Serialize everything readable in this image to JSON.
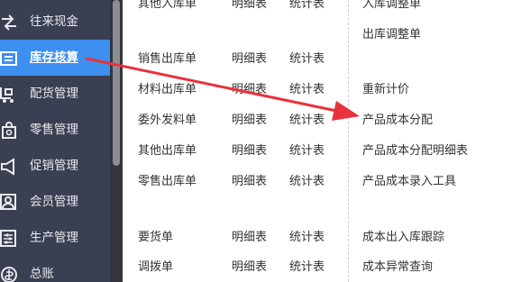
{
  "sidebar": {
    "items": [
      {
        "label": "往来现金",
        "icon": "cash-flow-icon"
      },
      {
        "label": "库存核算",
        "icon": "inventory-ledger-icon",
        "active": true
      },
      {
        "label": "配货管理",
        "icon": "distribution-icon"
      },
      {
        "label": "零售管理",
        "icon": "retail-icon"
      },
      {
        "label": "促销管理",
        "icon": "megaphone-icon"
      },
      {
        "label": "会员管理",
        "icon": "member-icon"
      },
      {
        "label": "生产管理",
        "icon": "production-icon"
      },
      {
        "label": "总账",
        "icon": "ledger-icon"
      }
    ]
  },
  "menu": {
    "rows": [
      {
        "name": "其他入库单",
        "detail": "明细表",
        "stats": "统计表"
      },
      {
        "name": "销售出库单",
        "detail": "明细表",
        "stats": "统计表"
      },
      {
        "name": "材料出库单",
        "detail": "明细表",
        "stats": "统计表"
      },
      {
        "name": "委外发料单",
        "detail": "明细表",
        "stats": "统计表"
      },
      {
        "name": "其他出库单",
        "detail": "明细表",
        "stats": "统计表"
      },
      {
        "name": "零售出库单",
        "detail": "明细表",
        "stats": "统计表"
      },
      {
        "name": "要货单",
        "detail": "明细表",
        "stats": "统计表"
      },
      {
        "name": "调拨单",
        "detail": "明细表",
        "stats": "统计表"
      }
    ],
    "right": [
      "入库调整单",
      "出库调整单",
      "重新计价",
      "产品成本分配",
      "产品成本分配明细表",
      "产品成本录入工具",
      "成本出入库跟踪",
      "成本异常查询"
    ]
  },
  "annotation": {
    "color": "#e8323c"
  },
  "theme": {
    "sidebar_bg": "#3a3f51",
    "active_bg": "#3d8ff0"
  }
}
